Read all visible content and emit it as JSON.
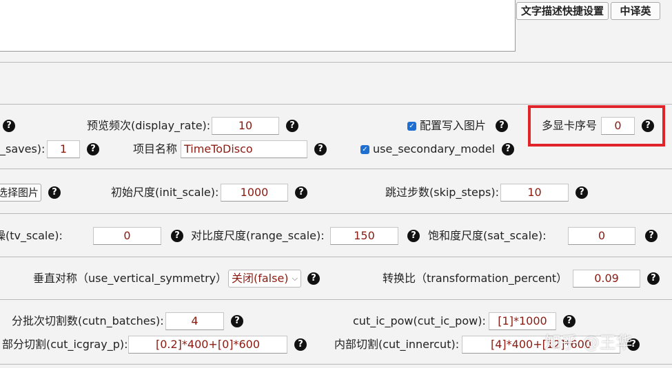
{
  "top": {
    "desc_shortcut_btn": "文字描述快捷设置",
    "translate_btn": "中译英"
  },
  "row1": {
    "display_rate_label": "预览频次(display_rate):",
    "display_rate_value": "10",
    "write_config_label": "配置写入图片",
    "gpu_index_label": "多显卡序号",
    "gpu_index_value": "0"
  },
  "row2": {
    "n_saves_label": "_saves):",
    "n_saves_value": "1",
    "project_name_label": "项目名称",
    "project_name_value": "TimeToDisco",
    "use_secondary_model_label": "use_secondary_model"
  },
  "row3": {
    "select_image_btn": "选择图片",
    "init_scale_label": "初始尺度(init_scale):",
    "init_scale_value": "1000",
    "skip_steps_label": "跳过步数(skip_steps):",
    "skip_steps_value": "10"
  },
  "row4": {
    "tv_scale_label": "噪(tv_scale):",
    "tv_scale_value": "0",
    "range_scale_label": "对比度尺度(range_scale):",
    "range_scale_value": "150",
    "sat_scale_label": "饱和度尺度(sat_scale):",
    "sat_scale_value": "0"
  },
  "row5": {
    "vertical_symmetry_label": "垂直对称（use_vertical_symmetry）",
    "vertical_symmetry_value": "关闭(false)",
    "transformation_label": "转换比（transformation_percent）",
    "transformation_value": "0.09"
  },
  "row6": {
    "cutn_batches_label": "分批次切割数(cutn_batches):",
    "cutn_batches_value": "4",
    "cut_ic_pow_label": "cut_ic_pow(cut_ic_pow):",
    "cut_ic_pow_value": "[1]*1000"
  },
  "row7": {
    "cut_icgray_label": "部分切割(cut_icgray_p):",
    "cut_icgray_value": "[0.2]*400+[0]*600",
    "cut_innercut_label": "内部切割(cut_innercut):",
    "cut_innercut_value": "[4]*400+[12]*600"
  },
  "help_glyph": "?",
  "watermark": "知乎 @王华",
  "colors": {
    "value_text": "#8b1a10",
    "highlight_border": "#e0242a",
    "checkbox": "#1f6fd0"
  }
}
